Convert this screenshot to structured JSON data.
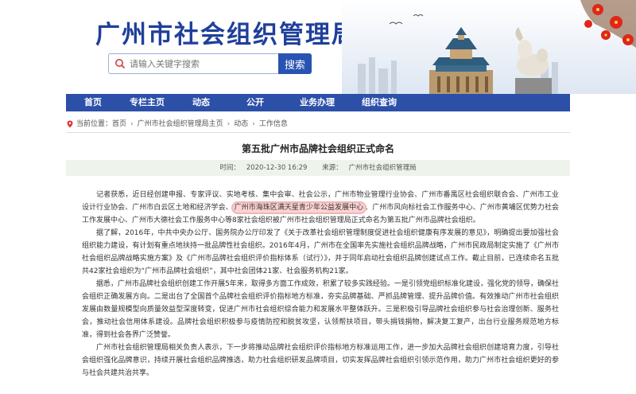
{
  "header": {
    "title": "广州市社会组织管理局",
    "search_placeholder": "请输入关键字搜索",
    "search_button": "搜索"
  },
  "nav": {
    "items": [
      "首页",
      "专栏主页",
      "动态",
      "公开",
      "业务办理",
      "组织查询"
    ]
  },
  "breadcrumb": {
    "prefix": "当前位置：",
    "items": [
      "首页",
      "广州市社会组织管理局主页",
      "动态",
      "工作信息"
    ]
  },
  "article": {
    "title": "第五批广州市品牌社会组织正式命名",
    "time_label": "时间：",
    "time": "2020-12-30 16:29",
    "source_label": "来源：",
    "source": "广州市社会组织管理局",
    "p1a": "记者获悉，近日经创建申报、专家评议、实地考核、集中会审、社会公示，广州市物业管理行业协会、广州市番禺区社会组织联合会、广州市工业设计行业协会、广州市白云区土地和经济学会、",
    "p1_highlight": "广州市海珠区满天星青少年公益发展中心",
    "p1b": "、广州市风向标社会工作服务中心、广州市黄埔区优势力社会工作发展中心、广州市大德社会工作服务中心等8家社会组织被广州市社会组织管理局正式命名为第五批广州市品牌社会组织。",
    "p2": "据了解，2016年，中共中央办公厅、国务院办公厅印发了《关于改革社会组织管理制度促进社会组织健康有序发展的意见》，明确提出要加强社会组织能力建设，有计划有重点地扶持一批品牌性社会组织。2016年4月，广州市在全国率先实施社会组织品牌战略，广州市民政局制定实施了《广州市社会组织品牌战略实施方案》及《广州市品牌社会组织评价指标体系（试行）》，并于同年启动社会组织品牌创建试点工作。截止目前，已连续命名五批共42家社会组织为“广州市品牌社会组织”，其中社会团体21家、社会服务机构21家。",
    "p3": "据悉，广州市品牌社会组织创建工作开展5年来，取得多方面工作成效，积累了较多实践经验。一是引领党组织标准化建设，强化党的领导，确保社会组织正确发展方向。二是出台了全国首个品牌社会组织评价指标地方标准，夯实品牌基础、严抓品牌管理、提升品牌价值。有效推动广州市社会组织发展由数量规模型向质量效益型深度转变，促进广州市社会组织综合能力和发展水平整体跃升。三是积极引导品牌社会组织参与社会治理创新、服务社会，推动社会信用体系建设。品牌社会组织积极参与疫情防控和脱贫攻坚，认领帮扶项目，带头捐钱捐物，解决复工复产，出台行业服务规范地方标准，得到社会各界广泛赞誉。",
    "p4": "广州市社会组织管理局相关负责人表示，下一步将推动品牌社会组织评价指标地方标准运用工作，进一步加大品牌社会组织创建培育力度，引导社会组织强化品牌意识，持续开展社会组织品牌推选，助力社会组织研发品牌项目，切实发挥品牌社会组织引领示范作用，助力广州市社会组织更好的参与社会共建共治共享。"
  },
  "colors": {
    "brand_blue": "#2c4fa8",
    "title_blue": "#1f3f9a",
    "meta_bg": "#eef4ec",
    "highlight": "#fbd3d3"
  }
}
